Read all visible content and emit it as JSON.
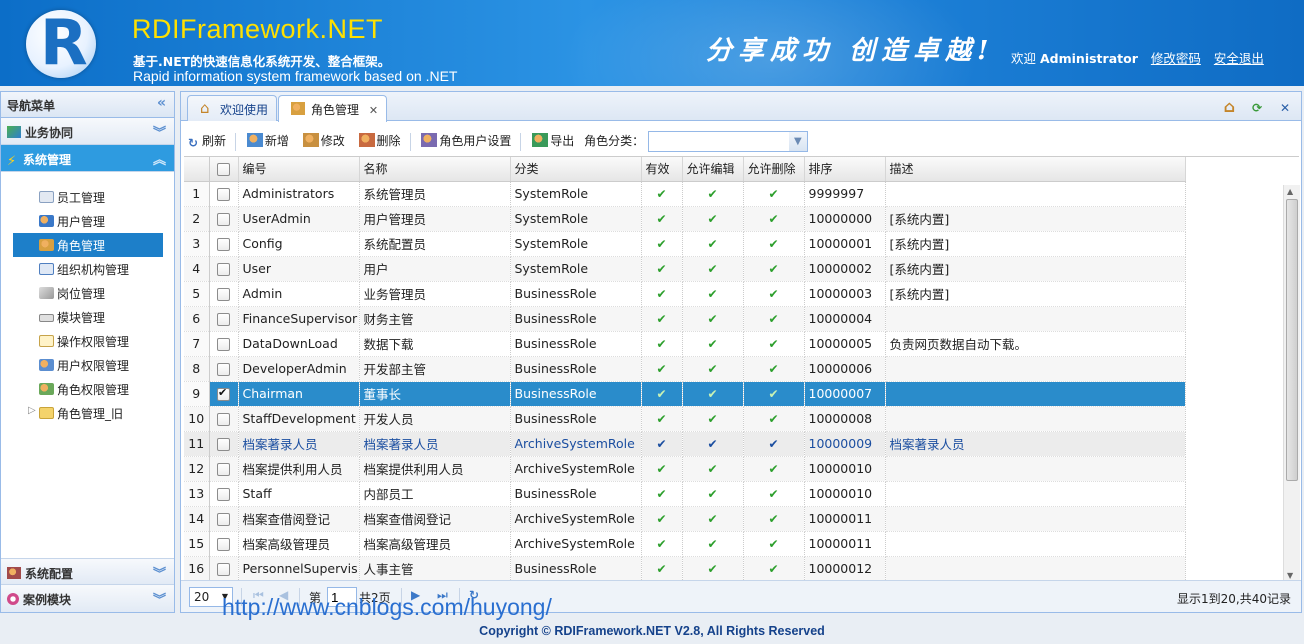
{
  "header": {
    "logo_letter": "R",
    "brand": "RDIFramework.NET",
    "tagline_cn": "基于.NET的快速信息化系统开发、整合框架。",
    "tagline_en": "Rapid information system framework based on .NET",
    "slogan": "分享成功 创造卓越!",
    "welcome": "欢迎",
    "username": "Administrator",
    "change_password": "修改密码",
    "logout": "安全退出"
  },
  "sidebar": {
    "title": "导航菜单",
    "groups": [
      {
        "label": "业务协同"
      },
      {
        "label": "系统管理"
      },
      {
        "label": "系统配置"
      },
      {
        "label": "案例模块"
      }
    ],
    "items": [
      {
        "label": "员工管理"
      },
      {
        "label": "用户管理"
      },
      {
        "label": "角色管理"
      },
      {
        "label": "组织机构管理"
      },
      {
        "label": "岗位管理"
      },
      {
        "label": "模块管理"
      },
      {
        "label": "操作权限管理"
      },
      {
        "label": "用户权限管理"
      },
      {
        "label": "角色权限管理"
      },
      {
        "label": "角色管理_旧"
      }
    ]
  },
  "tabs": [
    {
      "label": "欢迎使用"
    },
    {
      "label": "角色管理"
    }
  ],
  "toolbar": {
    "refresh": "刷新",
    "add": "新增",
    "edit": "修改",
    "delete": "删除",
    "role_users": "角色用户设置",
    "export": "导出",
    "category_label": "角色分类：",
    "category_value": ""
  },
  "grid": {
    "columns": [
      "编号",
      "名称",
      "分类",
      "有效",
      "允许编辑",
      "允许删除",
      "排序",
      "描述"
    ],
    "check_glyph": "✔",
    "rows": [
      {
        "n": "1",
        "code": "Administrators",
        "name": "系统管理员",
        "cat": "SystemRole",
        "sort": "9999997",
        "desc": ""
      },
      {
        "n": "2",
        "code": "UserAdmin",
        "name": "用户管理员",
        "cat": "SystemRole",
        "sort": "10000000",
        "desc": "[系统内置]"
      },
      {
        "n": "3",
        "code": "Config",
        "name": "系统配置员",
        "cat": "SystemRole",
        "sort": "10000001",
        "desc": "[系统内置]"
      },
      {
        "n": "4",
        "code": "User",
        "name": "用户",
        "cat": "SystemRole",
        "sort": "10000002",
        "desc": "[系统内置]"
      },
      {
        "n": "5",
        "code": "Admin",
        "name": "业务管理员",
        "cat": "BusinessRole",
        "sort": "10000003",
        "desc": "[系统内置]"
      },
      {
        "n": "6",
        "code": "FinanceSupervisor",
        "name": "财务主管",
        "cat": "BusinessRole",
        "sort": "10000004",
        "desc": ""
      },
      {
        "n": "7",
        "code": "DataDownLoad",
        "name": "数据下载",
        "cat": "BusinessRole",
        "sort": "10000005",
        "desc": "负责网页数据自动下载。"
      },
      {
        "n": "8",
        "code": "DeveloperAdmin",
        "name": "开发部主管",
        "cat": "BusinessRole",
        "sort": "10000006",
        "desc": ""
      },
      {
        "n": "9",
        "code": "Chairman",
        "name": "董事长",
        "cat": "BusinessRole",
        "sort": "10000007",
        "desc": ""
      },
      {
        "n": "10",
        "code": "StaffDevelopment",
        "name": "开发人员",
        "cat": "BusinessRole",
        "sort": "10000008",
        "desc": ""
      },
      {
        "n": "11",
        "code": "档案著录人员",
        "name": "档案著录人员",
        "cat": "ArchiveSystemRole",
        "sort": "10000009",
        "desc": "档案著录人员"
      },
      {
        "n": "12",
        "code": "档案提供利用人员",
        "name": "档案提供利用人员",
        "cat": "ArchiveSystemRole",
        "sort": "10000010",
        "desc": ""
      },
      {
        "n": "13",
        "code": "Staff",
        "name": "内部员工",
        "cat": "BusinessRole",
        "sort": "10000010",
        "desc": ""
      },
      {
        "n": "14",
        "code": "档案查借阅登记",
        "name": "档案查借阅登记",
        "cat": "ArchiveSystemRole",
        "sort": "10000011",
        "desc": ""
      },
      {
        "n": "15",
        "code": "档案高级管理员",
        "name": "档案高级管理员",
        "cat": "ArchiveSystemRole",
        "sort": "10000011",
        "desc": ""
      },
      {
        "n": "16",
        "code": "PersonnelSupervis",
        "name": "人事主管",
        "cat": "BusinessRole",
        "sort": "10000012",
        "desc": ""
      }
    ]
  },
  "pager": {
    "page_size": "20",
    "page_prefix": "第",
    "page_value": "1",
    "page_total": "共2页",
    "info": "显示1到20,共40记录"
  },
  "watermark": "http://www.cnblogs.com/huyong/",
  "footer": "Copyright © RDIFramework.NET V2.8, All Rights Reserved"
}
